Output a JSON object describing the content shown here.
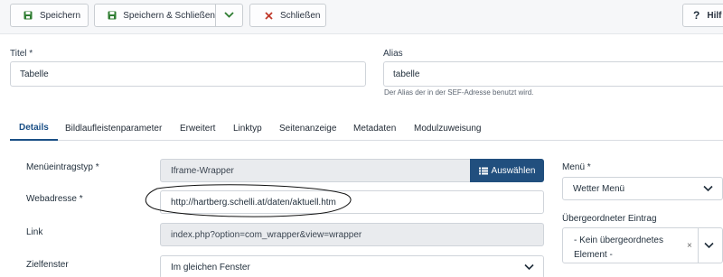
{
  "toolbar": {
    "save_label": "Speichern",
    "save_close_label": "Speichern & Schließen",
    "close_label": "Schließen",
    "help_label": "Hilf"
  },
  "fields": {
    "title_label": "Titel *",
    "title_value": "Tabelle",
    "alias_label": "Alias",
    "alias_value": "tabelle",
    "alias_help": "Der Alias der in der SEF-Adresse benutzt wird."
  },
  "tabs": [
    {
      "label": "Details",
      "active": true
    },
    {
      "label": "Bildlaufleistenparameter"
    },
    {
      "label": "Erweitert"
    },
    {
      "label": "Linktyp"
    },
    {
      "label": "Seitenanzeige"
    },
    {
      "label": "Metadaten"
    },
    {
      "label": "Modulzuweisung"
    }
  ],
  "details": {
    "menu_item_type_label": "Menüeintragstyp *",
    "menu_item_type_value": "Iframe-Wrapper",
    "choose_label": "Auswählen",
    "url_label": "Webadresse *",
    "url_value": "http://hartberg.schelli.at/daten/aktuell.htm",
    "link_label": "Link",
    "link_value": "index.php?option=com_wrapper&view=wrapper",
    "target_label": "Zielfenster",
    "target_value": "Im gleichen Fenster"
  },
  "sidebar": {
    "menu_label": "Menü *",
    "menu_value": "Wetter Menü",
    "parent_label": "Übergeordneter Eintrag",
    "parent_value": "- Kein übergeordnetes Element -",
    "parent_clear": "×"
  },
  "colors": {
    "primary": "#214f7e",
    "save_icon": "#2f7d32",
    "close_icon": "#c0392b",
    "tab_active": "#1a4f86"
  }
}
